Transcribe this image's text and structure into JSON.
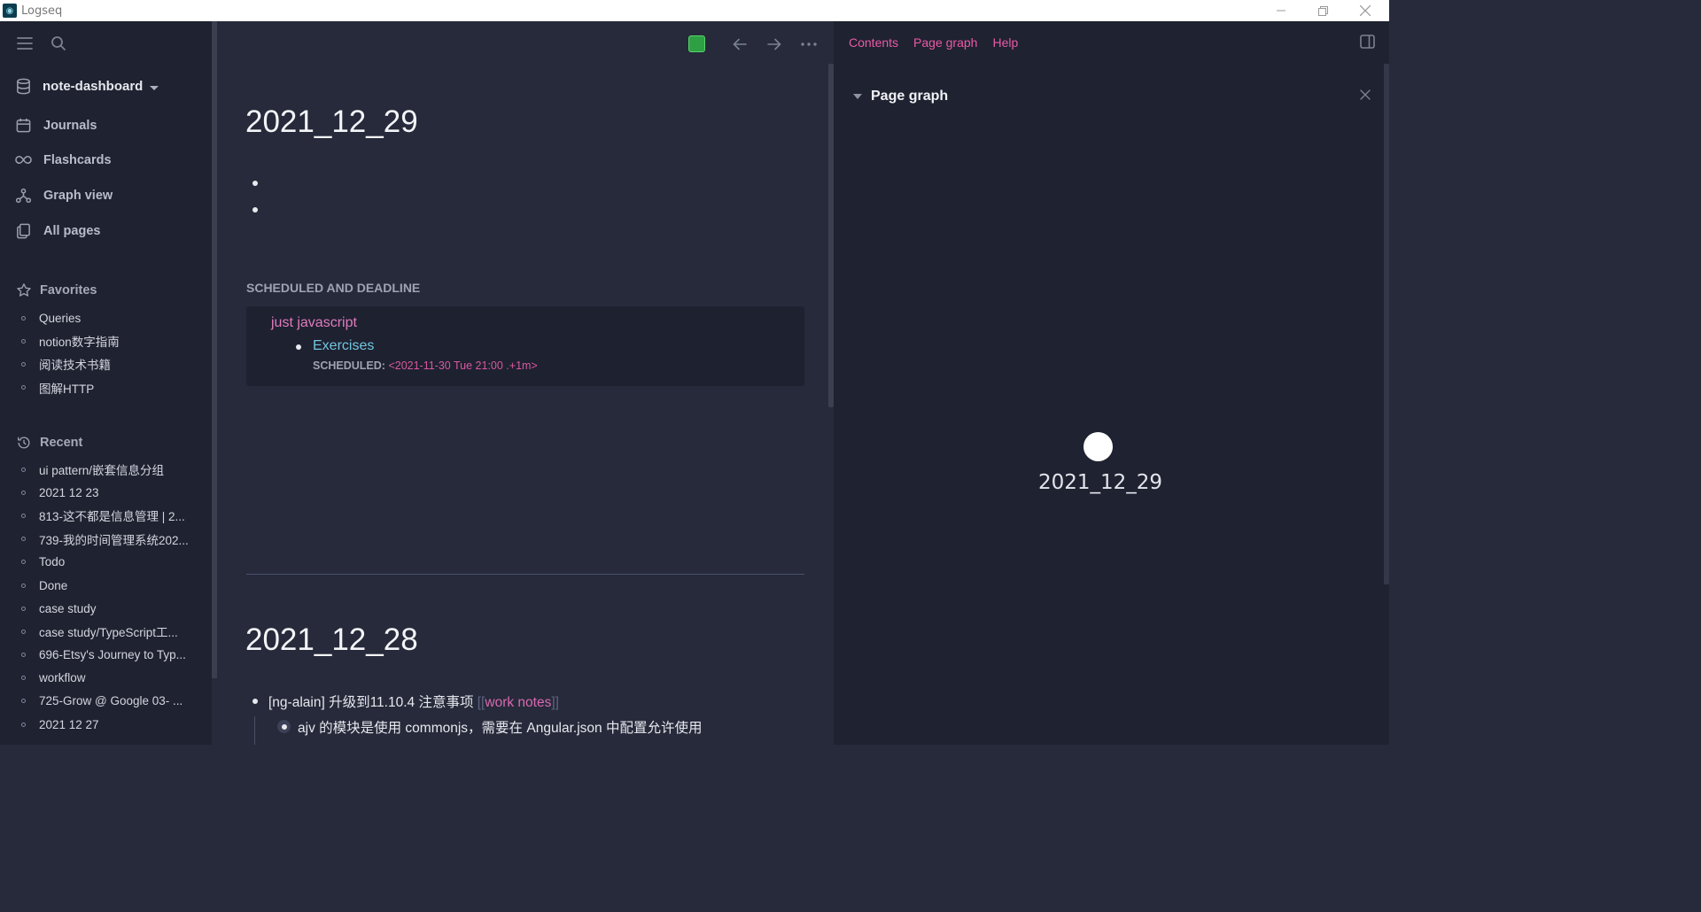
{
  "window": {
    "title": "Logseq",
    "controls": [
      "minimize-icon",
      "restore-icon",
      "close-icon"
    ]
  },
  "sidebar": {
    "graph_name": "note-dashboard",
    "nav": [
      {
        "label": "Journals",
        "icon": "calendar-icon"
      },
      {
        "label": "Flashcards",
        "icon": "infinity-icon"
      },
      {
        "label": "Graph view",
        "icon": "graph-icon"
      },
      {
        "label": "All pages",
        "icon": "pages-icon"
      }
    ],
    "favorites": {
      "title": "Favorites",
      "items": [
        "Queries",
        "notion数字指南",
        "阅读技术书籍",
        "图解HTTP"
      ]
    },
    "recent": {
      "title": "Recent",
      "items": [
        "ui pattern/嵌套信息分组",
        "2021 12 23",
        "813-这不都是信息管理 | 2...",
        "739-我的时间管理系统202...",
        "Todo",
        "Done",
        "case study",
        "case study/TypeScript工...",
        "696-Etsy's Journey to Typ...",
        "workflow",
        "725-Grow @ Google 03- ...",
        "2021 12 27",
        "..."
      ]
    }
  },
  "main": {
    "journals": [
      {
        "title": "2021_12_29"
      },
      {
        "title": "2021_12_28"
      }
    ],
    "scheduled": {
      "heading": "SCHEDULED AND DEADLINE",
      "page": "just javascript",
      "block": "Exercises",
      "meta_label": "SCHEDULED:",
      "meta_value": "<2021-11-30 Tue 21:00 .+1m>"
    },
    "blocks_1228": [
      {
        "text": "[ng-alain] 升级到11.10.4 注意事项 ",
        "ref_open": "[[",
        "ref": "work notes",
        "ref_close": "]]"
      },
      {
        "text": "ajv 的模块是使用 commonjs，需要在 Angular.json 中配置允许使用"
      }
    ]
  },
  "right_panel": {
    "tabs": [
      "Contents",
      "Page graph",
      "Help"
    ],
    "section_title": "Page graph",
    "node_label": "2021_12_29"
  },
  "colors": {
    "accent_pink": "#ea5aa8",
    "link_cyan": "#73c6e0",
    "status_green": "#2ea043"
  }
}
